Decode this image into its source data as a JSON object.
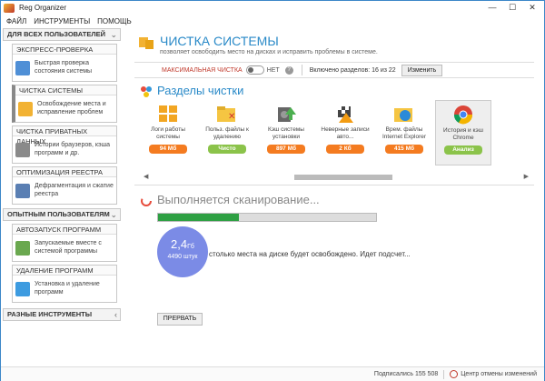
{
  "window": {
    "title": "Reg Organizer",
    "controls": [
      "—",
      "☐",
      "✕"
    ]
  },
  "menu": [
    "ФАЙЛ",
    "ИНСТРУМЕНТЫ",
    "ПОМОЩЬ"
  ],
  "sidebar": {
    "section_all": "ДЛЯ ВСЕХ ПОЛЬЗОВАТЕЛЕЙ",
    "section_exp": "ОПЫТНЫМ ПОЛЬЗОВАТЕЛЯМ",
    "section_misc": "РАЗНЫЕ ИНСТРУМЕНТЫ",
    "groups": [
      {
        "title": "ЭКСПРЕСС-ПРОВЕРКА",
        "text": "Быстрая проверка состояния системы"
      },
      {
        "title": "ЧИСТКА СИСТЕМЫ",
        "text": "Освобождение места и исправление проблем"
      },
      {
        "title": "ЧИСТКА ПРИВАТНЫХ ДАННЫХ",
        "text": "Истории браузеров, кэша программ и др."
      },
      {
        "title": "ОПТИМИЗАЦИЯ РЕЕСТРА",
        "text": "Дефрагментация и сжатие реестра"
      },
      {
        "title": "АВТОЗАПУСК ПРОГРАММ",
        "text": "Запускаемые вместе с системой программы"
      },
      {
        "title": "УДАЛЕНИЕ ПРОГРАММ",
        "text": "Установка и удаление программ"
      }
    ]
  },
  "main": {
    "title": "ЧИСТКА СИСТЕМЫ",
    "subtitle": "позволяет освободить место на дисках и исправить проблемы в системе.",
    "max_clean": "МАКСИМАЛЬНАЯ ЧИСТКА",
    "toggle_state": "НЕТ",
    "enabled": "Включено разделов: 16 из 22",
    "change_btn": "Изменить",
    "sections_title": "Разделы чистки",
    "cards": [
      {
        "label": "Логи работы системы",
        "badge": "94 Мб",
        "color": "#f47b20"
      },
      {
        "label": "Польз. файлы к удалению",
        "badge": "Чисто",
        "color": "#8bc34a"
      },
      {
        "label": "Кэш системы установки",
        "badge": "897 Мб",
        "color": "#f47b20"
      },
      {
        "label": "Неверные записи авто...",
        "badge": "2 Кб",
        "color": "#f47b20"
      },
      {
        "label": "Врем. файлы Internet Explorer",
        "badge": "415 Мб",
        "color": "#f47b20"
      },
      {
        "label": "История и кэш Chrome",
        "badge": "Анализ",
        "color": "#8bc34a"
      }
    ],
    "scan_title": "Выполняется сканирование...",
    "progress": 0.37,
    "bubble_size": "2,4",
    "bubble_unit": "Гб",
    "bubble_count": "4490 штук",
    "scan_msg": "столько места на диске будет освобождено. Идет подсчет...",
    "stop_btn": "ПРЕРВАТЬ"
  },
  "status": {
    "subscribers": "Подписались 155 508",
    "undo": "Центр отмены изменений"
  }
}
